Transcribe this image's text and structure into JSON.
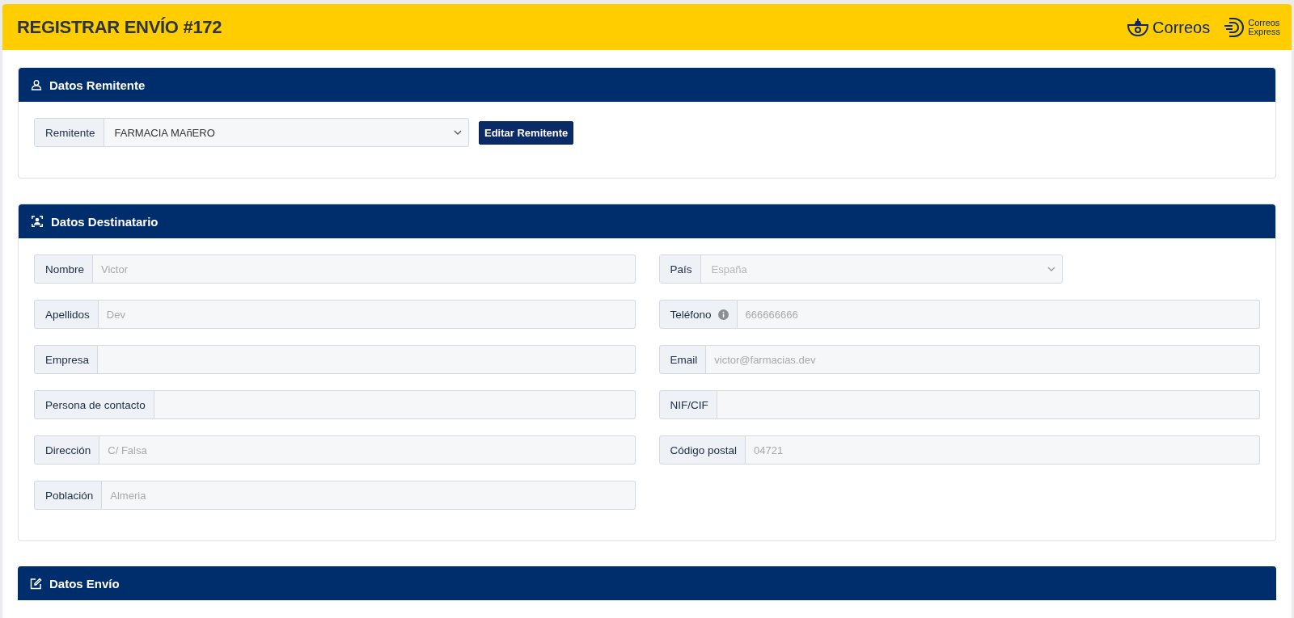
{
  "header": {
    "title": "REGISTRAR ENVÍO #172",
    "logos": [
      {
        "kind": "correos",
        "lines": [
          "Correos"
        ]
      },
      {
        "kind": "express",
        "lines": [
          "Correos",
          "Express"
        ]
      }
    ]
  },
  "sender": {
    "title": "Datos Remitente",
    "label": "Remitente",
    "value": "FARMACIA MAñERO",
    "button": "Editar Remitente"
  },
  "recipient": {
    "title": "Datos Destinatario",
    "left": [
      {
        "kind": "input",
        "label": "Nombre",
        "placeholder": "Victor"
      },
      {
        "kind": "input",
        "label": "Apellidos",
        "placeholder": "Dev"
      },
      {
        "kind": "input",
        "label": "Empresa"
      },
      {
        "kind": "input",
        "label": "Persona de contacto"
      },
      {
        "kind": "input",
        "label": "Dirección",
        "placeholder": "C/ Falsa"
      },
      {
        "kind": "input",
        "label": "Población",
        "placeholder": "Almeria"
      }
    ],
    "right": [
      {
        "kind": "select",
        "label": "País",
        "value": "España",
        "disabled": true
      },
      {
        "kind": "input",
        "label": "Teléfono",
        "info": true,
        "placeholder": "666666666"
      },
      {
        "kind": "input",
        "label": "Email",
        "placeholder": "victor@farmacias.dev"
      },
      {
        "kind": "input",
        "label": "NIF/CIF"
      },
      {
        "kind": "input",
        "label": "Código postal",
        "placeholder": "04721"
      }
    ]
  },
  "shipment": {
    "title": "Datos Envío"
  }
}
